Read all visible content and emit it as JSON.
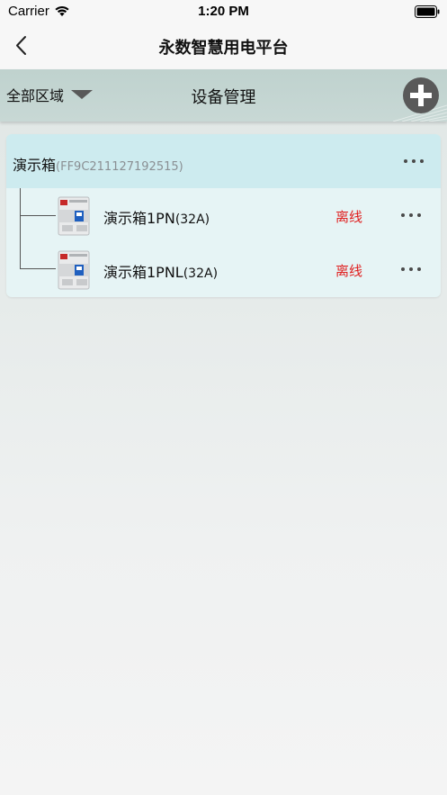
{
  "status_bar": {
    "carrier": "Carrier",
    "time": "1:20 PM"
  },
  "nav": {
    "title": "永数智慧用电平台"
  },
  "toolbar": {
    "area_label": "全部区域",
    "title": "设备管理"
  },
  "group": {
    "name": "演示箱",
    "mac": "(FF9C211127192515)",
    "devices": [
      {
        "name": "演示箱1PN",
        "rating": "(32A)",
        "status": "离线"
      },
      {
        "name": "演示箱1PNL",
        "rating": "(32A)",
        "status": "离线"
      }
    ]
  },
  "colors": {
    "toolbar_bg": "#c4d6d2",
    "group_header_bg": "#cdebef",
    "group_body_bg": "#e6f4f5",
    "status_offline": "#e02020",
    "add_button": "#595959"
  }
}
